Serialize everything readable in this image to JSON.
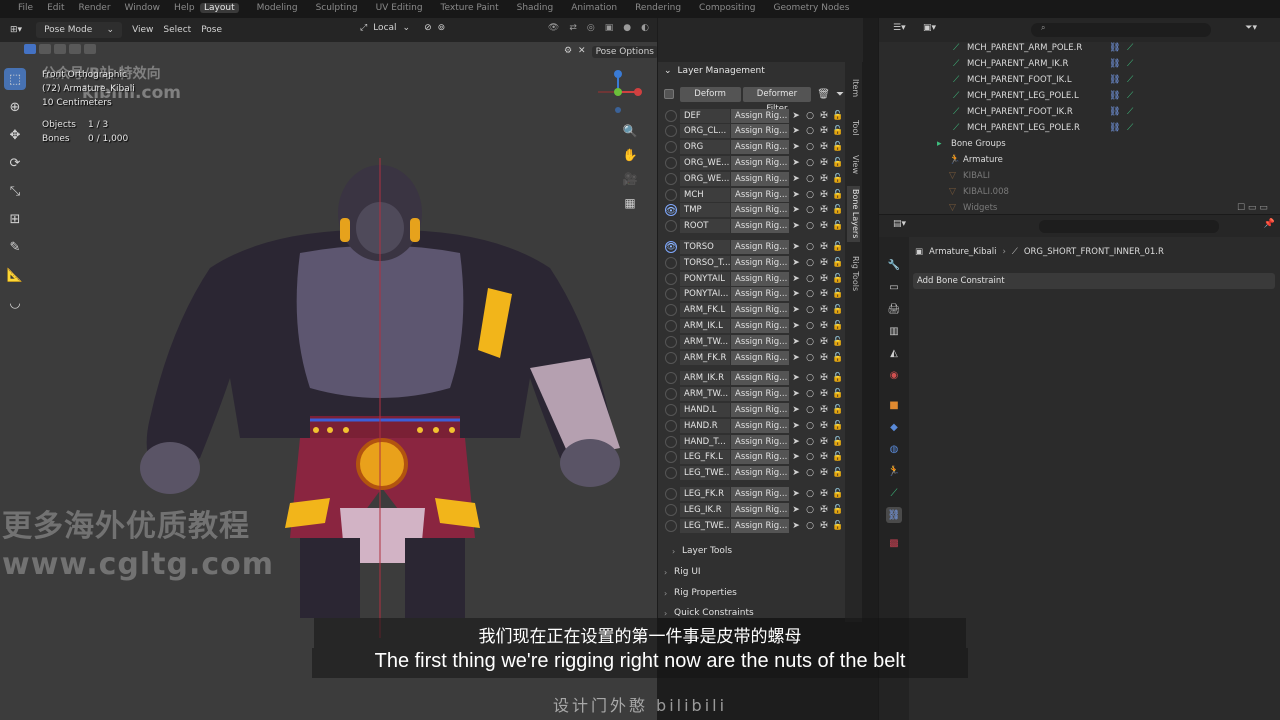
{
  "topbar": {
    "menu": [
      "File",
      "Edit",
      "Render",
      "Window",
      "Help"
    ],
    "workspaces": [
      "Layout",
      "Modeling",
      "Sculpting",
      "UV Editing",
      "Texture Paint",
      "Shading",
      "Animation",
      "Rendering",
      "Compositing",
      "Geometry Nodes"
    ],
    "active_workspace": "Layout"
  },
  "viewport": {
    "mode": "Pose Mode",
    "menus": [
      "View",
      "Select",
      "Pose"
    ],
    "orientation": "Local",
    "pose_options": "Pose Options",
    "info": {
      "view": "Front Orthographic",
      "object": "(72) Armature_Kibali",
      "scale": "10 Centimeters",
      "objects_label": "Objects",
      "objects_value": "1 / 3",
      "bones_label": "Bones",
      "bones_value": "0 / 1,000"
    }
  },
  "watermarks": {
    "top": "公众号/B站  特效向",
    "top2": "kibini.com",
    "bottom1": "更多海外优质教程",
    "bottom2": "www.cgltg.com"
  },
  "layer_management": {
    "title": "Layer Management",
    "deform_btn": "Deform",
    "deformer_filter_btn": "Deformer Filter",
    "assign_label": "Assign Rig...",
    "groups": [
      [
        {
          "name": "DEF",
          "visible": false
        },
        {
          "name": "ORG_CL...",
          "visible": false
        },
        {
          "name": "ORG",
          "visible": false
        },
        {
          "name": "ORG_WE...",
          "visible": false
        },
        {
          "name": "ORG_WE...",
          "visible": false
        },
        {
          "name": "MCH",
          "visible": false
        },
        {
          "name": "TMP",
          "visible": true
        },
        {
          "name": "ROOT",
          "visible": false
        }
      ],
      [
        {
          "name": "TORSO",
          "visible": true
        },
        {
          "name": "TORSO_T...",
          "visible": false
        },
        {
          "name": "PONYTAIL",
          "visible": false
        },
        {
          "name": "PONYTAI...",
          "visible": false
        },
        {
          "name": "ARM_FK.L",
          "visible": false
        },
        {
          "name": "ARM_IK.L",
          "visible": false
        },
        {
          "name": "ARM_TW...",
          "visible": false
        },
        {
          "name": "ARM_FK.R",
          "visible": false
        }
      ],
      [
        {
          "name": "ARM_IK.R",
          "visible": false
        },
        {
          "name": "ARM_TW...",
          "visible": false
        },
        {
          "name": "HAND.L",
          "visible": false
        },
        {
          "name": "HAND.R",
          "visible": false
        },
        {
          "name": "HAND_T...",
          "visible": false
        },
        {
          "name": "LEG_FK.L",
          "visible": false
        },
        {
          "name": "LEG_TWE...",
          "visible": false
        }
      ],
      [
        {
          "name": "LEG_FK.R",
          "visible": false
        },
        {
          "name": "LEG_IK.R",
          "visible": false
        },
        {
          "name": "LEG_TWE...",
          "visible": false
        }
      ]
    ],
    "sections": [
      "Layer Tools",
      "Rig UI",
      "Rig Properties",
      "Quick Constraints"
    ]
  },
  "npanel_tabs": [
    "Item",
    "Tool",
    "View",
    "Bone Layers",
    "Rig Tools"
  ],
  "outliner": {
    "rows": [
      {
        "label": "MCH_PARENT_ARM_POLE.R",
        "kind": "bone"
      },
      {
        "label": "MCH_PARENT_ARM_IK.R",
        "kind": "bone"
      },
      {
        "label": "MCH_PARENT_FOOT_IK.L",
        "kind": "bone"
      },
      {
        "label": "MCH_PARENT_LEG_POLE.L",
        "kind": "bone"
      },
      {
        "label": "MCH_PARENT_FOOT_IK.R",
        "kind": "bone"
      },
      {
        "label": "MCH_PARENT_LEG_POLE.R",
        "kind": "bone"
      },
      {
        "label": "Bone Groups",
        "kind": "group"
      },
      {
        "label": "Armature",
        "kind": "armature"
      },
      {
        "label": "KIBALI",
        "kind": "dim"
      },
      {
        "label": "KIBALI.008",
        "kind": "dim"
      },
      {
        "label": "Widgets",
        "kind": "dim"
      }
    ]
  },
  "properties": {
    "breadcrumb_object": "Armature_Kibali",
    "breadcrumb_bone": "ORG_SHORT_FRONT_INNER_01.R",
    "add_constraint": "Add Bone Constraint"
  },
  "subtitles": {
    "cn": "我们现在正在设置的第一件事是皮带的螺母",
    "en": "The first thing we're rigging right now are the nuts of the belt",
    "mark": "设计门外憨 bilibili"
  }
}
